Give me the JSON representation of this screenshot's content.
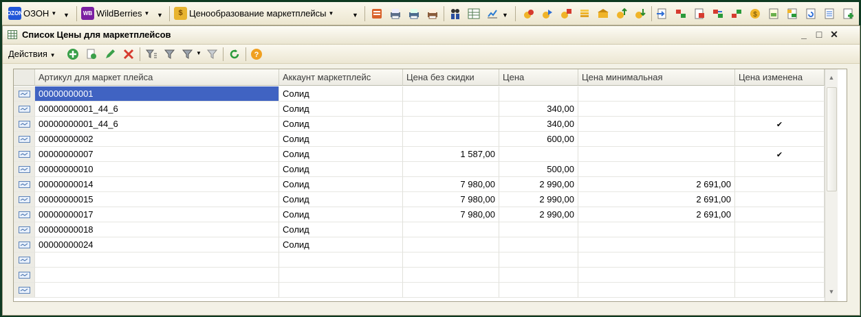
{
  "toolbar": {
    "ozon_label": "ОЗОН",
    "ozon_logo": "OZON",
    "wb_label": "WildBerries",
    "wb_logo": "WB",
    "pricing_label": "Ценообразование маркетплейсы"
  },
  "window": {
    "title": "Список Цены для маркетплейсов"
  },
  "cmdbar": {
    "actions_label": "Действия"
  },
  "table": {
    "columns": [
      "Артикул для маркет плейса",
      "Аккаунт маркетплейс",
      "Цена без скидки",
      "Цена",
      "Цена минимальная",
      "Цена изменена"
    ],
    "rows": [
      {
        "article": "00000000001",
        "account": "Солид",
        "price_no_discount": "",
        "price": "",
        "price_min": "",
        "changed": false
      },
      {
        "article": "00000000001_44_6",
        "account": "Солид",
        "price_no_discount": "",
        "price": "340,00",
        "price_min": "",
        "changed": false
      },
      {
        "article": "00000000001_44_6",
        "account": "Солид",
        "price_no_discount": "",
        "price": "340,00",
        "price_min": "",
        "changed": true
      },
      {
        "article": "00000000002",
        "account": "Солид",
        "price_no_discount": "",
        "price": "600,00",
        "price_min": "",
        "changed": false
      },
      {
        "article": "00000000007",
        "account": "Солид",
        "price_no_discount": "1 587,00",
        "price": "",
        "price_min": "",
        "changed": true
      },
      {
        "article": "00000000010",
        "account": "Солид",
        "price_no_discount": "",
        "price": "500,00",
        "price_min": "",
        "changed": false
      },
      {
        "article": "00000000014",
        "account": "Солид",
        "price_no_discount": "7 980,00",
        "price": "2 990,00",
        "price_min": "2 691,00",
        "changed": false
      },
      {
        "article": "00000000015",
        "account": "Солид",
        "price_no_discount": "7 980,00",
        "price": "2 990,00",
        "price_min": "2 691,00",
        "changed": false
      },
      {
        "article": "00000000017",
        "account": "Солид",
        "price_no_discount": "7 980,00",
        "price": "2 990,00",
        "price_min": "2 691,00",
        "changed": false
      },
      {
        "article": "00000000018",
        "account": "Солид",
        "price_no_discount": "",
        "price": "",
        "price_min": "",
        "changed": false
      },
      {
        "article": "00000000024",
        "account": "Солид",
        "price_no_discount": "",
        "price": "",
        "price_min": "",
        "changed": false
      },
      {
        "article": "",
        "account": "",
        "price_no_discount": "",
        "price": "",
        "price_min": "",
        "changed": false
      },
      {
        "article": "",
        "account": "",
        "price_no_discount": "",
        "price": "",
        "price_min": "",
        "changed": false
      },
      {
        "article": "",
        "account": "",
        "price_no_discount": "",
        "price": "",
        "price_min": "",
        "changed": false
      }
    ],
    "selected_row": 0,
    "check_glyph": "✔"
  },
  "colors": {
    "selection": "#4063c2",
    "border_frame": "#0f3a22",
    "ozon_blue": "#2157d9",
    "wb_purple": "#7b1fa2"
  }
}
